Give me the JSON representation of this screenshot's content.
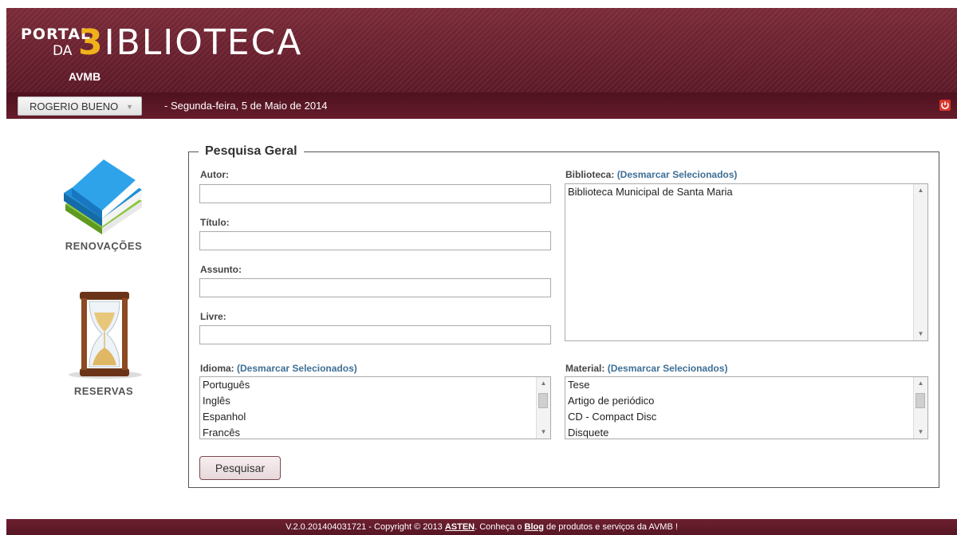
{
  "header": {
    "logo_portal": "PORTAL",
    "logo_da": "DA",
    "logo_b": "3",
    "logo_rest": "IBLIOTECA",
    "subtitle": "AVMB"
  },
  "userbar": {
    "user_name": "ROGERIO BUENO",
    "date": "-  Segunda-feira, 5 de Maio de 2014",
    "logout_icon": "power-icon"
  },
  "sidebar": {
    "items": [
      {
        "label": "RENOVAÇÕES",
        "icon": "books-icon"
      },
      {
        "label": "RESERVAS",
        "icon": "hourglass-icon"
      }
    ]
  },
  "search": {
    "legend": "Pesquisa Geral",
    "autor_label": "Autor:",
    "titulo_label": "Título:",
    "assunto_label": "Assunto:",
    "livre_label": "Livre:",
    "biblioteca_label": "Biblioteca:",
    "deselect_link": "(Desmarcar Selecionados)",
    "idioma_label": "Idioma:",
    "material_label": "Material:",
    "bibliotecas": [
      "Biblioteca Municipal de Santa Maria"
    ],
    "idiomas": [
      "Português",
      "Inglês",
      "Espanhol",
      "Francês"
    ],
    "materiais": [
      "Tese",
      "Artigo de periódico",
      "CD - Compact Disc",
      "Disquete"
    ],
    "submit_label": "Pesquisar"
  },
  "footer": {
    "prefix": "V.2.0.201404031721 - Copyright © 2013 ",
    "asten": "ASTEN",
    "middle": ". Conheça o ",
    "blog": "Blog",
    "suffix": " de produtos e serviços da AVMB !"
  },
  "colors": {
    "brand": "#6b2232",
    "accent": "#f0b21b",
    "link": "#3e6f96"
  }
}
